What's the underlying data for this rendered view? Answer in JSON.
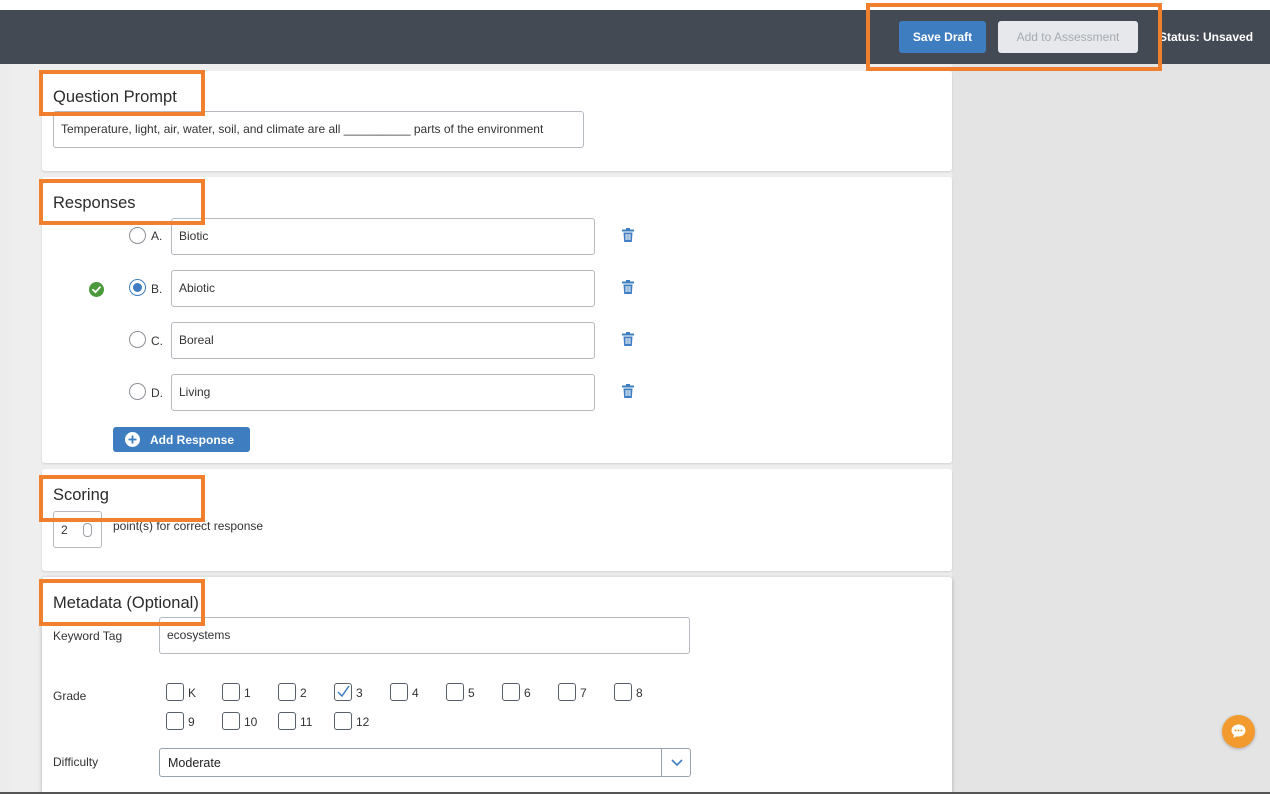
{
  "header": {
    "save_draft_label": "Save Draft",
    "add_to_assessment_label": "Add to Assessment",
    "status_text": "Status: Unsaved"
  },
  "question_prompt": {
    "title": "Question Prompt",
    "value": "Temperature, light, air, water, soil, and climate are all __________ parts of the environment"
  },
  "responses": {
    "title": "Responses",
    "items": [
      {
        "letter": "A.",
        "text": "Biotic",
        "correct": false
      },
      {
        "letter": "B.",
        "text": "Abiotic",
        "correct": true
      },
      {
        "letter": "C.",
        "text": "Boreal",
        "correct": false
      },
      {
        "letter": "D.",
        "text": "Living",
        "correct": false
      }
    ],
    "add_label": "Add Response"
  },
  "scoring": {
    "title": "Scoring",
    "points": "2",
    "points_suffix": "point(s) for correct response"
  },
  "metadata": {
    "title": "Metadata (Optional)",
    "keyword_label": "Keyword Tag",
    "keyword_value": "ecosystems",
    "grade_label": "Grade",
    "grades": [
      {
        "label": "K",
        "checked": false
      },
      {
        "label": "1",
        "checked": false
      },
      {
        "label": "2",
        "checked": false
      },
      {
        "label": "3",
        "checked": true
      },
      {
        "label": "4",
        "checked": false
      },
      {
        "label": "5",
        "checked": false
      },
      {
        "label": "6",
        "checked": false
      },
      {
        "label": "7",
        "checked": false
      },
      {
        "label": "8",
        "checked": false
      },
      {
        "label": "9",
        "checked": false
      },
      {
        "label": "10",
        "checked": false
      },
      {
        "label": "11",
        "checked": false
      },
      {
        "label": "12",
        "checked": false
      }
    ],
    "difficulty_label": "Difficulty",
    "difficulty_value": "Moderate"
  },
  "colors": {
    "header_bg": "#434a54",
    "primary_blue": "#3e7dc0",
    "highlight_orange": "#f0802d",
    "correct_green": "#4a9a3c",
    "chat_orange": "#f29a2e"
  },
  "icons": {
    "delete": "trash-icon",
    "correct": "check-circle-icon",
    "add": "plus-circle-icon",
    "dropdown": "chevron-down-icon",
    "chat": "chat-bubble-icon"
  }
}
